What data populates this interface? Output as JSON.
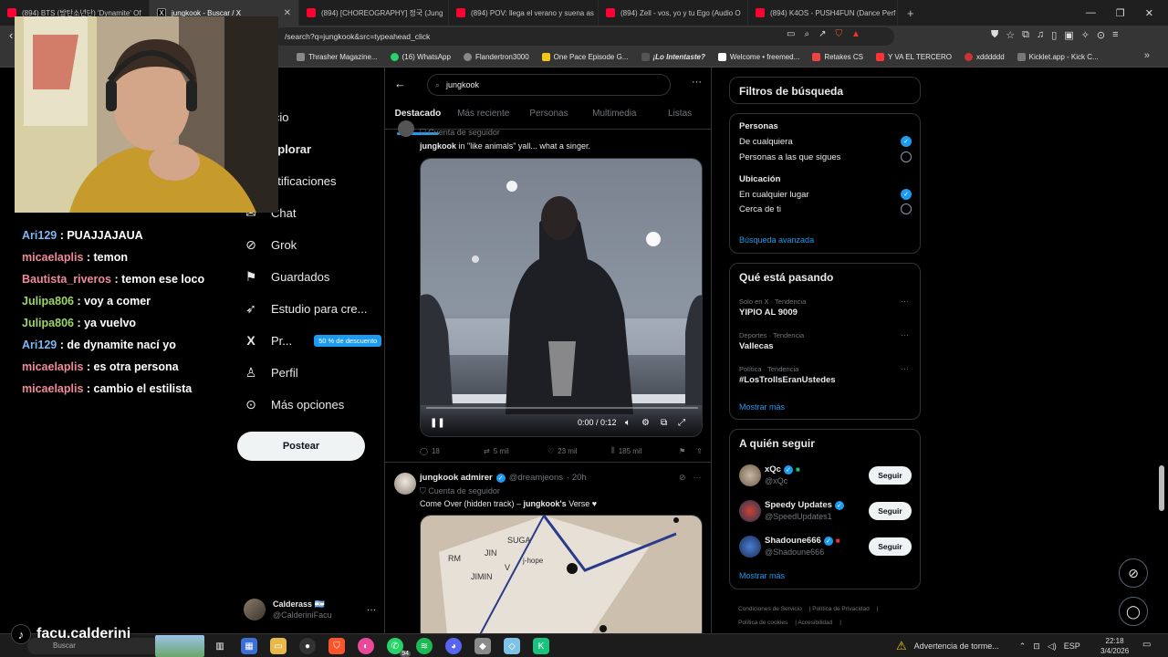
{
  "browser": {
    "tabs": [
      {
        "title": "(894) BTS (방탄소년단) 'Dynamite' Of",
        "favicon": "youtube-icon"
      },
      {
        "title": "jungkook - Buscar / X",
        "favicon": "x-icon",
        "active": true
      },
      {
        "title": "(894) [CHOREOGRAPHY] 정국 (Jung",
        "favicon": "youtube-icon"
      },
      {
        "title": "(894) POV: llega el verano y suena as",
        "favicon": "youtube-icon"
      },
      {
        "title": "(894) Zell - vos, yo y tu Ego (Audio O",
        "favicon": "youtube-icon"
      },
      {
        "title": "(894) K4OS - PUSH4FUN (Dance Perf",
        "favicon": "youtube-icon"
      }
    ],
    "url": "/search?q=jungkook&src=typeahead_click",
    "bookmarks": [
      "Thrasher Magazine...",
      "(16) WhatsApp",
      "Flandertron3000",
      "One Pace Episode G...",
      "¡Lo Intentaste?",
      "Welcome • freemed...",
      "Retakes CS",
      "Y VA EL TERCERO",
      "xdddddd",
      "Kicklet.app - Kick C..."
    ]
  },
  "nav": {
    "items": [
      {
        "label": "icio",
        "icon": "home-icon"
      },
      {
        "label": "xplorar",
        "icon": "search-icon"
      },
      {
        "label": "otificaciones",
        "icon": "bell-icon"
      },
      {
        "label": "Chat",
        "icon": "chat-icon"
      },
      {
        "label": "Grok",
        "icon": "grok-icon"
      },
      {
        "label": "Guardados",
        "icon": "bookmark-icon"
      },
      {
        "label": "Estudio para cre...",
        "icon": "rocket-icon"
      },
      {
        "label": "Pr...",
        "icon": "x-logo-icon"
      },
      {
        "label": "Perfil",
        "icon": "person-icon"
      },
      {
        "label": "Más opciones",
        "icon": "more-circle-icon"
      }
    ],
    "promo_badge": "50 % de descuento",
    "post_button": "Postear",
    "profile": {
      "name": "Calderass 🇦🇷",
      "handle": "@CalderiniFacu"
    }
  },
  "search": {
    "query": "jungkook",
    "tabs": [
      "Destacado",
      "Más reciente",
      "Personas",
      "Multimedia",
      "Listas"
    ],
    "active_tab": "Destacado"
  },
  "tweet1": {
    "context": "Cuenta de seguidor",
    "author": "jungkook",
    "text": " in \"like animals\" yall... what a singer.",
    "video": {
      "time": "0:00 / 0:12"
    },
    "stats": {
      "replies": "18",
      "reposts": "5 mil",
      "likes": "23 mil",
      "views": "185 mil"
    }
  },
  "tweet2": {
    "author": "jungkook admirer",
    "handle": "@dreamjeons",
    "time": "· 20h",
    "context": "Cuenta de seguidor",
    "text_pre": "Come Over (hidden track) – ",
    "text_bold": "jungkook's",
    "text_post": " Verse ♥",
    "photo_labels": [
      "RM",
      "JIN",
      "SUGA",
      "JIMIN",
      "V",
      "j-hope"
    ]
  },
  "filters": {
    "title": "Filtros de búsqueda",
    "people_heading": "Personas",
    "people_options": [
      "De cualquiera",
      "Personas a las que sigues"
    ],
    "location_heading": "Ubicación",
    "location_options": [
      "En cualquier lugar",
      "Cerca de ti"
    ],
    "advanced_link": "Búsqueda avanzada"
  },
  "trends": {
    "title": "Qué está pasando",
    "items": [
      {
        "category": "Solo en X · Tendencia",
        "name": "YIPIO AL 9009"
      },
      {
        "category": "Deportes · Tendencia",
        "name": "Vallecas"
      },
      {
        "category": "Política · Tendencia",
        "name": "#LosTrollsEranUstedes"
      }
    ],
    "more": "Mostrar más"
  },
  "who_to_follow": {
    "title": "A quién seguir",
    "accounts": [
      {
        "name": "xQc",
        "handle": "@xQc"
      },
      {
        "name": "Speedy Updates",
        "handle": "@SpeedUpdates1"
      },
      {
        "name": "Shadoune666",
        "handle": "@Shadoune666"
      }
    ],
    "follow_label": "Seguir",
    "more": "Mostrar más"
  },
  "footer": [
    "Condiciones de Servicio",
    "Política de Privacidad",
    "Política de cookies",
    "Accesibilidad"
  ],
  "stream": {
    "chat": [
      {
        "user": "Ari129",
        "msg": "PUAJJAJAUA",
        "color": "u1"
      },
      {
        "user": "micaelaplis",
        "msg": "temon",
        "color": "u2"
      },
      {
        "user": "Bautista_riveros",
        "msg": "temon ese loco",
        "color": "u2"
      },
      {
        "user": "Julipa806",
        "msg": "voy a comer",
        "color": "u3"
      },
      {
        "user": "Julipa806",
        "msg": "ya vuelvo",
        "color": "u3"
      },
      {
        "user": "Ari129",
        "msg": "de dynamite nací yo",
        "color": "u1"
      },
      {
        "user": "micaelaplis",
        "msg": "es otra persona",
        "color": "u2"
      },
      {
        "user": "micaelaplis",
        "msg": "cambio el estilista",
        "color": "u2"
      }
    ],
    "tiktok_name": "facu.calderini"
  },
  "taskbar": {
    "search_placeholder": "Buscar",
    "weather_alert": "Advertencia de torme...",
    "lang": "ESP",
    "time": "22:18",
    "date": "3/4/2026",
    "badge": "94"
  },
  "colors": {
    "accent": "#1d9bf0",
    "bg": "#000000",
    "border": "#2f3336",
    "muted": "#71767b"
  }
}
